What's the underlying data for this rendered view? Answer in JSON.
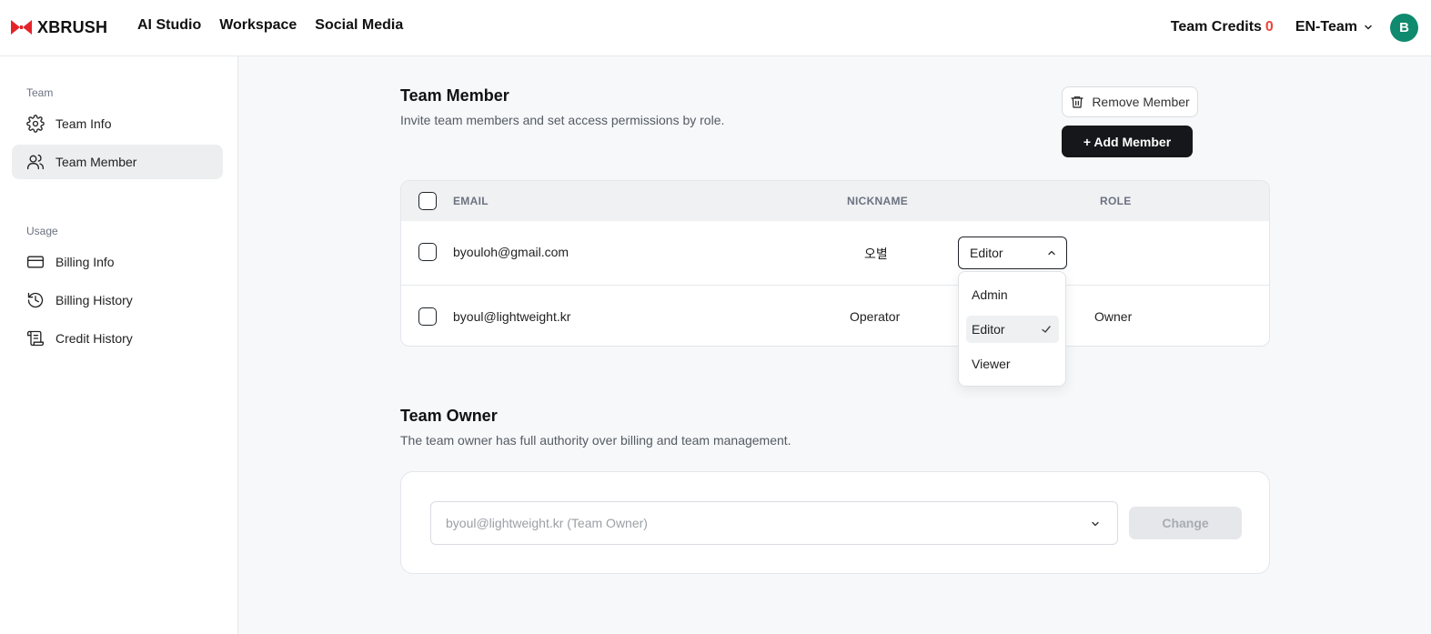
{
  "header": {
    "logo_text": "XBRUSH",
    "brand_color": "#e5242a",
    "nav": [
      "AI Studio",
      "Workspace",
      "Social Media"
    ],
    "credits_label": "Team Credits",
    "credits_value": "0",
    "team_name": "EN-Team",
    "avatar_initial": "B",
    "avatar_color": "#0f8a6e"
  },
  "sidebar": {
    "section_team": "Team",
    "team_info": "Team Info",
    "team_member": "Team Member",
    "section_usage": "Usage",
    "billing_info": "Billing Info",
    "billing_history": "Billing History",
    "credit_history": "Credit History"
  },
  "members": {
    "title": "Team Member",
    "description": "Invite team members and set access permissions by role.",
    "remove_label": "Remove Member",
    "add_label": "+ Add Member",
    "columns": {
      "email": "EMAIL",
      "nickname": "NICKNAME",
      "role": "ROLE"
    },
    "rows": [
      {
        "email": "byouloh@gmail.com",
        "nickname": "오별",
        "role": "Editor"
      },
      {
        "email": "byoul@lightweight.kr",
        "nickname": "Operator",
        "role": "Owner"
      }
    ],
    "role_options": [
      "Admin",
      "Editor",
      "Viewer"
    ],
    "selected_role": "Editor"
  },
  "owner": {
    "title": "Team Owner",
    "description": "The team owner has full authority over billing and team management.",
    "select_value": "byoul@lightweight.kr (Team Owner)",
    "change_label": "Change"
  }
}
